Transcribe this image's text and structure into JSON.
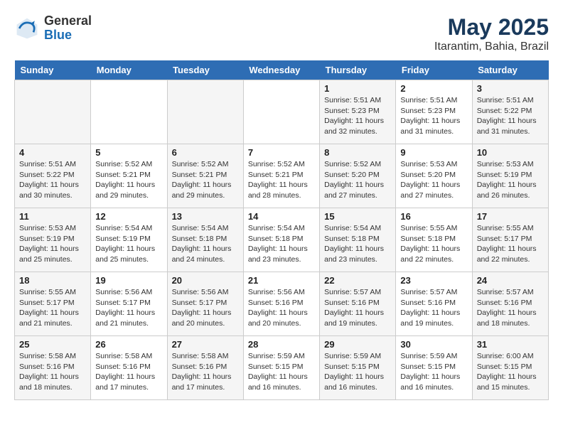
{
  "header": {
    "logo_general": "General",
    "logo_blue": "Blue",
    "title": "May 2025",
    "subtitle": "Itarantim, Bahia, Brazil"
  },
  "weekdays": [
    "Sunday",
    "Monday",
    "Tuesday",
    "Wednesday",
    "Thursday",
    "Friday",
    "Saturday"
  ],
  "weeks": [
    [
      {
        "day": "",
        "info": ""
      },
      {
        "day": "",
        "info": ""
      },
      {
        "day": "",
        "info": ""
      },
      {
        "day": "",
        "info": ""
      },
      {
        "day": "1",
        "info": "Sunrise: 5:51 AM\nSunset: 5:23 PM\nDaylight: 11 hours\nand 32 minutes."
      },
      {
        "day": "2",
        "info": "Sunrise: 5:51 AM\nSunset: 5:23 PM\nDaylight: 11 hours\nand 31 minutes."
      },
      {
        "day": "3",
        "info": "Sunrise: 5:51 AM\nSunset: 5:22 PM\nDaylight: 11 hours\nand 31 minutes."
      }
    ],
    [
      {
        "day": "4",
        "info": "Sunrise: 5:51 AM\nSunset: 5:22 PM\nDaylight: 11 hours\nand 30 minutes."
      },
      {
        "day": "5",
        "info": "Sunrise: 5:52 AM\nSunset: 5:21 PM\nDaylight: 11 hours\nand 29 minutes."
      },
      {
        "day": "6",
        "info": "Sunrise: 5:52 AM\nSunset: 5:21 PM\nDaylight: 11 hours\nand 29 minutes."
      },
      {
        "day": "7",
        "info": "Sunrise: 5:52 AM\nSunset: 5:21 PM\nDaylight: 11 hours\nand 28 minutes."
      },
      {
        "day": "8",
        "info": "Sunrise: 5:52 AM\nSunset: 5:20 PM\nDaylight: 11 hours\nand 27 minutes."
      },
      {
        "day": "9",
        "info": "Sunrise: 5:53 AM\nSunset: 5:20 PM\nDaylight: 11 hours\nand 27 minutes."
      },
      {
        "day": "10",
        "info": "Sunrise: 5:53 AM\nSunset: 5:19 PM\nDaylight: 11 hours\nand 26 minutes."
      }
    ],
    [
      {
        "day": "11",
        "info": "Sunrise: 5:53 AM\nSunset: 5:19 PM\nDaylight: 11 hours\nand 25 minutes."
      },
      {
        "day": "12",
        "info": "Sunrise: 5:54 AM\nSunset: 5:19 PM\nDaylight: 11 hours\nand 25 minutes."
      },
      {
        "day": "13",
        "info": "Sunrise: 5:54 AM\nSunset: 5:18 PM\nDaylight: 11 hours\nand 24 minutes."
      },
      {
        "day": "14",
        "info": "Sunrise: 5:54 AM\nSunset: 5:18 PM\nDaylight: 11 hours\nand 23 minutes."
      },
      {
        "day": "15",
        "info": "Sunrise: 5:54 AM\nSunset: 5:18 PM\nDaylight: 11 hours\nand 23 minutes."
      },
      {
        "day": "16",
        "info": "Sunrise: 5:55 AM\nSunset: 5:18 PM\nDaylight: 11 hours\nand 22 minutes."
      },
      {
        "day": "17",
        "info": "Sunrise: 5:55 AM\nSunset: 5:17 PM\nDaylight: 11 hours\nand 22 minutes."
      }
    ],
    [
      {
        "day": "18",
        "info": "Sunrise: 5:55 AM\nSunset: 5:17 PM\nDaylight: 11 hours\nand 21 minutes."
      },
      {
        "day": "19",
        "info": "Sunrise: 5:56 AM\nSunset: 5:17 PM\nDaylight: 11 hours\nand 21 minutes."
      },
      {
        "day": "20",
        "info": "Sunrise: 5:56 AM\nSunset: 5:17 PM\nDaylight: 11 hours\nand 20 minutes."
      },
      {
        "day": "21",
        "info": "Sunrise: 5:56 AM\nSunset: 5:16 PM\nDaylight: 11 hours\nand 20 minutes."
      },
      {
        "day": "22",
        "info": "Sunrise: 5:57 AM\nSunset: 5:16 PM\nDaylight: 11 hours\nand 19 minutes."
      },
      {
        "day": "23",
        "info": "Sunrise: 5:57 AM\nSunset: 5:16 PM\nDaylight: 11 hours\nand 19 minutes."
      },
      {
        "day": "24",
        "info": "Sunrise: 5:57 AM\nSunset: 5:16 PM\nDaylight: 11 hours\nand 18 minutes."
      }
    ],
    [
      {
        "day": "25",
        "info": "Sunrise: 5:58 AM\nSunset: 5:16 PM\nDaylight: 11 hours\nand 18 minutes."
      },
      {
        "day": "26",
        "info": "Sunrise: 5:58 AM\nSunset: 5:16 PM\nDaylight: 11 hours\nand 17 minutes."
      },
      {
        "day": "27",
        "info": "Sunrise: 5:58 AM\nSunset: 5:16 PM\nDaylight: 11 hours\nand 17 minutes."
      },
      {
        "day": "28",
        "info": "Sunrise: 5:59 AM\nSunset: 5:15 PM\nDaylight: 11 hours\nand 16 minutes."
      },
      {
        "day": "29",
        "info": "Sunrise: 5:59 AM\nSunset: 5:15 PM\nDaylight: 11 hours\nand 16 minutes."
      },
      {
        "day": "30",
        "info": "Sunrise: 5:59 AM\nSunset: 5:15 PM\nDaylight: 11 hours\nand 16 minutes."
      },
      {
        "day": "31",
        "info": "Sunrise: 6:00 AM\nSunset: 5:15 PM\nDaylight: 11 hours\nand 15 minutes."
      }
    ]
  ]
}
